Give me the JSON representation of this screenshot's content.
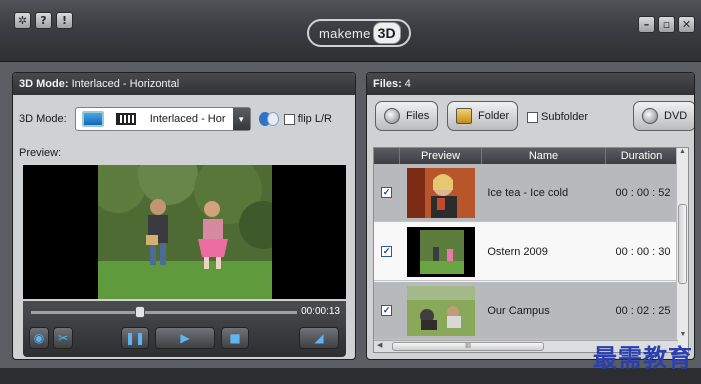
{
  "app": {
    "logo_text": "makeme",
    "logo_badge": "3D"
  },
  "toolbar_icons": [
    "settings-icon",
    "help-icon",
    "info-icon"
  ],
  "window_controls": [
    "minimize",
    "maximize",
    "close"
  ],
  "left_panel": {
    "header_label": "3D Mode:",
    "header_value": "Interlaced - Horizontal",
    "mode_label": "3D Mode:",
    "mode_selected": "Interlaced - Hor",
    "flip_label": "flip L/R",
    "preview_label": "Preview:",
    "time": "00:00:13",
    "progress": 0.41
  },
  "right_panel": {
    "header_label": "Files:",
    "header_count": "4",
    "buttons": {
      "files": "Files",
      "folder": "Folder",
      "subfolder": "Subfolder",
      "dvd": "DVD"
    },
    "columns": [
      "Preview",
      "Name",
      "Duration"
    ],
    "rows": [
      {
        "name": "Ice tea - Ice cold",
        "duration": "00 : 00 : 52",
        "checked": true
      },
      {
        "name": "Ostern 2009",
        "duration": "00 : 00 : 30",
        "checked": true
      },
      {
        "name": "Our Campus",
        "duration": "00 : 02 : 25",
        "checked": true
      }
    ],
    "scroll_label": "III"
  },
  "watermark": "最需教育",
  "colors": {
    "accent": "#2b57a5",
    "watermark": "#2b3fb1"
  }
}
